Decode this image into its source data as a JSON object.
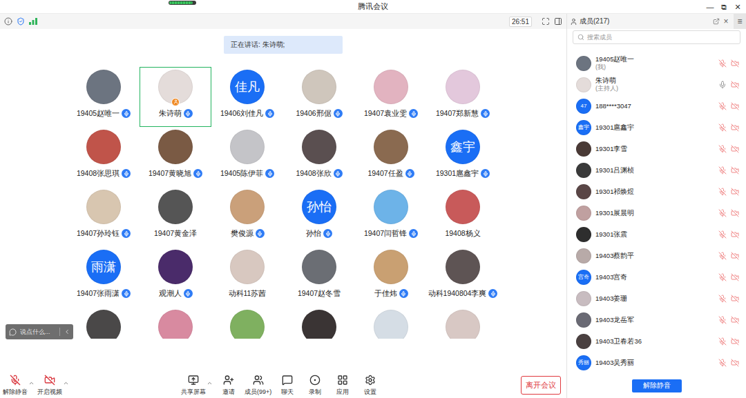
{
  "window": {
    "title": "腾讯会议",
    "controls": [
      "—",
      "⧉",
      "✕"
    ]
  },
  "network_indicator": {
    "level": 0.9
  },
  "info_bar": {
    "timer": "26:51"
  },
  "speaking_banner": "正在讲话: 朱诗萌;",
  "participants": [
    {
      "name": "19405赵唯一",
      "avatar": {
        "kind": "photo",
        "color": "#6c7480"
      },
      "mic": true,
      "speaking": false,
      "host": false
    },
    {
      "name": "朱诗萌",
      "avatar": {
        "kind": "photo",
        "color": "#e4dcda"
      },
      "mic": true,
      "speaking": true,
      "host": true
    },
    {
      "name": "19406刘佳凡",
      "avatar": {
        "kind": "text",
        "label": "佳凡",
        "color": "#1a6ef5"
      },
      "mic": true,
      "speaking": false,
      "host": false
    },
    {
      "name": "19406邢倨",
      "avatar": {
        "kind": "photo",
        "color": "#cfc6bc"
      },
      "mic": true,
      "speaking": false,
      "host": false
    },
    {
      "name": "19407袁业雯",
      "avatar": {
        "kind": "photo",
        "color": "#e2b3c0"
      },
      "mic": true,
      "speaking": false,
      "host": false
    },
    {
      "name": "19407郑新慧",
      "avatar": {
        "kind": "photo",
        "color": "#e3c8dc"
      },
      "mic": true,
      "speaking": false,
      "host": false
    },
    {
      "name": "19408张思琪",
      "avatar": {
        "kind": "photo",
        "color": "#c0544a"
      },
      "mic": true,
      "speaking": false,
      "host": false
    },
    {
      "name": "19407黄晓旭",
      "avatar": {
        "kind": "photo",
        "color": "#7a5a44"
      },
      "mic": true,
      "speaking": false,
      "host": false
    },
    {
      "name": "19405陈伊菲",
      "avatar": {
        "kind": "photo",
        "color": "#c4c4c8"
      },
      "mic": true,
      "speaking": false,
      "host": false
    },
    {
      "name": "19408张欣",
      "avatar": {
        "kind": "photo",
        "color": "#5a4f50"
      },
      "mic": true,
      "speaking": false,
      "host": false
    },
    {
      "name": "19407任盈",
      "avatar": {
        "kind": "photo",
        "color": "#8a6a50"
      },
      "mic": true,
      "speaking": false,
      "host": false
    },
    {
      "name": "19301扈鑫宇",
      "avatar": {
        "kind": "text",
        "label": "鑫宇",
        "color": "#1a6ef5"
      },
      "mic": true,
      "speaking": false,
      "host": false
    },
    {
      "name": "19407孙玲钰",
      "avatar": {
        "kind": "photo",
        "color": "#d8c6b0"
      },
      "mic": true,
      "speaking": false,
      "host": false
    },
    {
      "name": "19407黄金泽",
      "avatar": {
        "kind": "photo",
        "color": "#555555"
      },
      "mic": false,
      "speaking": false,
      "host": false
    },
    {
      "name": "樊俊源",
      "avatar": {
        "kind": "photo",
        "color": "#caa07a"
      },
      "mic": true,
      "speaking": false,
      "host": false
    },
    {
      "name": "孙怡",
      "avatar": {
        "kind": "text",
        "label": "孙怡",
        "color": "#1a6ef5"
      },
      "mic": true,
      "speaking": false,
      "host": false
    },
    {
      "name": "19407闫哲锋",
      "avatar": {
        "kind": "photo",
        "color": "#6db3e8"
      },
      "mic": true,
      "speaking": false,
      "host": false
    },
    {
      "name": "19408杨义",
      "avatar": {
        "kind": "photo",
        "color": "#c85a5a"
      },
      "mic": false,
      "speaking": false,
      "host": false
    },
    {
      "name": "19407张雨潇",
      "avatar": {
        "kind": "text",
        "label": "雨潇",
        "color": "#1a6ef5"
      },
      "mic": true,
      "speaking": false,
      "host": false
    },
    {
      "name": "观潮人",
      "avatar": {
        "kind": "photo",
        "color": "#4a2b6a"
      },
      "mic": true,
      "speaking": false,
      "host": false
    },
    {
      "name": "动科11苏茜",
      "avatar": {
        "kind": "photo",
        "color": "#d8c8c0"
      },
      "mic": false,
      "speaking": false,
      "host": false
    },
    {
      "name": "19407赵冬雪",
      "avatar": {
        "kind": "photo",
        "color": "#6b6e74"
      },
      "mic": false,
      "speaking": false,
      "host": false
    },
    {
      "name": "于佳炜",
      "avatar": {
        "kind": "photo",
        "color": "#c9a072"
      },
      "mic": true,
      "speaking": false,
      "host": false
    },
    {
      "name": "动科1940804李爽",
      "avatar": {
        "kind": "photo",
        "color": "#5e5454"
      },
      "mic": true,
      "speaking": false,
      "host": false
    },
    {
      "avatar": {
        "kind": "photo",
        "color": "#4a4848"
      },
      "mic": false,
      "speaking": false,
      "host": false
    },
    {
      "avatar": {
        "kind": "photo",
        "color": "#d88aa0"
      },
      "mic": false,
      "speaking": false,
      "host": false
    },
    {
      "avatar": {
        "kind": "photo",
        "color": "#7fb060"
      },
      "mic": false,
      "speaking": false,
      "host": false
    },
    {
      "avatar": {
        "kind": "photo",
        "color": "#3a3434"
      },
      "mic": false,
      "speaking": false,
      "host": false
    },
    {
      "avatar": {
        "kind": "photo",
        "color": "#d5dde5"
      },
      "mic": false,
      "speaking": false,
      "host": false
    },
    {
      "avatar": {
        "kind": "photo",
        "color": "#d8c8c4"
      },
      "mic": false,
      "speaking": false,
      "host": false
    }
  ],
  "chat_input": {
    "placeholder": "说点什么..."
  },
  "toolbar": {
    "left": [
      {
        "label": "解除静音",
        "kind": "mic",
        "muted": true,
        "caret": true
      },
      {
        "label": "开启视频",
        "kind": "video",
        "muted": true,
        "caret": true
      }
    ],
    "center": [
      {
        "label": "共享屏幕",
        "kind": "share",
        "caret": true
      },
      {
        "label": "邀请",
        "kind": "invite",
        "caret": false
      },
      {
        "label": "成员(99+)",
        "kind": "members",
        "caret": false
      },
      {
        "label": "聊天",
        "kind": "chat",
        "caret": false
      },
      {
        "label": "录制",
        "kind": "record",
        "caret": false
      },
      {
        "label": "应用",
        "kind": "apps",
        "caret": false
      },
      {
        "label": "设置",
        "kind": "settings",
        "caret": false
      }
    ],
    "leave": "离开会议"
  },
  "members_panel": {
    "title": "成员(217)",
    "close": "×",
    "menu": "≡",
    "search": {
      "placeholder": "搜索成员"
    },
    "members": [
      {
        "name": "19405赵唯一",
        "note": "(我)",
        "avatar": {
          "kind": "photo",
          "color": "#6c7480"
        },
        "mic_muted": true,
        "video_muted": true
      },
      {
        "name": "朱诗萌",
        "note": "(主持人)",
        "avatar": {
          "kind": "photo",
          "color": "#e4dcda"
        },
        "mic_muted": false,
        "video_muted": true
      },
      {
        "name": "188****3047",
        "avatar": {
          "kind": "text",
          "label": "47",
          "color": "#1a6ef5"
        },
        "mic_muted": true,
        "video_muted": true
      },
      {
        "name": "19301扈鑫宇",
        "avatar": {
          "kind": "text",
          "label": "鑫宇",
          "color": "#1a6ef5"
        },
        "mic_muted": true,
        "video_muted": true
      },
      {
        "name": "19301李雪",
        "avatar": {
          "kind": "photo",
          "color": "#4a3a36"
        },
        "mic_muted": true,
        "video_muted": true
      },
      {
        "name": "19301吕渊桢",
        "avatar": {
          "kind": "photo",
          "color": "#3a3a3a"
        },
        "mic_muted": true,
        "video_muted": true
      },
      {
        "name": "19301祁焕煜",
        "avatar": {
          "kind": "photo",
          "color": "#5a4646"
        },
        "mic_muted": true,
        "video_muted": true
      },
      {
        "name": "19301展晨明",
        "avatar": {
          "kind": "photo",
          "color": "#c0a0a0"
        },
        "mic_muted": true,
        "video_muted": true
      },
      {
        "name": "19301张震",
        "avatar": {
          "kind": "photo",
          "color": "#2e2e2e"
        },
        "mic_muted": true,
        "video_muted": true
      },
      {
        "name": "19403蔡韵平",
        "avatar": {
          "kind": "photo",
          "color": "#b8aaa8"
        },
        "mic_muted": true,
        "video_muted": true
      },
      {
        "name": "19403宫奇",
        "avatar": {
          "kind": "text",
          "label": "宫奇",
          "color": "#1a6ef5"
        },
        "mic_muted": true,
        "video_muted": true
      },
      {
        "name": "19403姜珊",
        "avatar": {
          "kind": "photo",
          "color": "#c8bcc0"
        },
        "mic_muted": true,
        "video_muted": true
      },
      {
        "name": "19403龙岳军",
        "avatar": {
          "kind": "photo",
          "color": "#6a6a74"
        },
        "mic_muted": true,
        "video_muted": true
      },
      {
        "name": "19403卫春若36",
        "avatar": {
          "kind": "photo",
          "color": "#4a4040"
        },
        "mic_muted": true,
        "video_muted": true
      },
      {
        "name": "19403吴秀丽",
        "avatar": {
          "kind": "text",
          "label": "秀丽",
          "color": "#1a6ef5"
        },
        "mic_muted": true,
        "video_muted": true
      }
    ],
    "button": "解除静音"
  }
}
